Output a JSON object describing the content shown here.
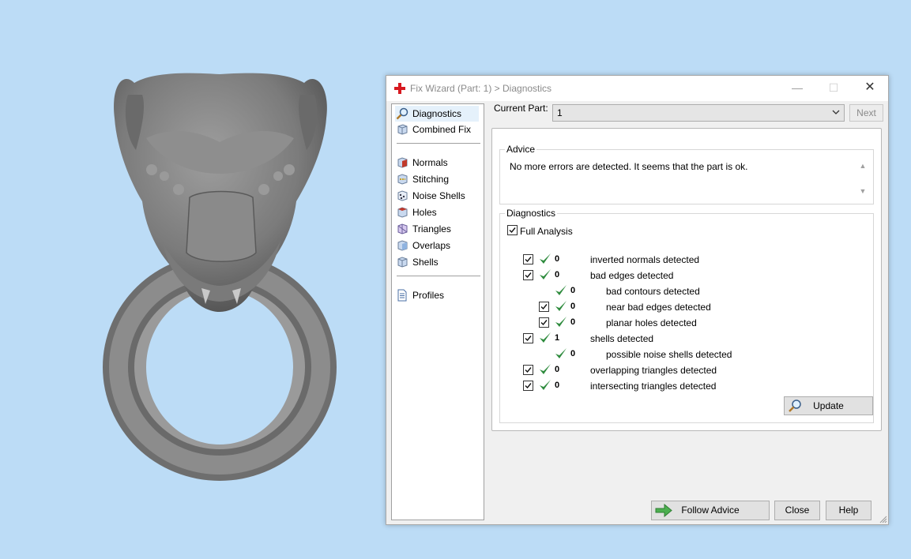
{
  "window": {
    "title": "Fix Wizard (Part: 1) > Diagnostics",
    "min_icon": "minimize-icon",
    "max_icon": "maximize-icon",
    "close_icon": "close-icon"
  },
  "sidebar": {
    "items_top": [
      {
        "label": "Diagnostics",
        "icon": "magnifier-icon",
        "selected": true
      },
      {
        "label": "Combined Fix",
        "icon": "cube-icon",
        "selected": false
      }
    ],
    "items_mid": [
      {
        "label": "Normals",
        "icon": "normals-cube-icon"
      },
      {
        "label": "Stitching",
        "icon": "stitching-cube-icon"
      },
      {
        "label": "Noise Shells",
        "icon": "noise-shells-cube-icon"
      },
      {
        "label": "Holes",
        "icon": "holes-cube-icon"
      },
      {
        "label": "Triangles",
        "icon": "triangles-cube-icon"
      },
      {
        "label": "Overlaps",
        "icon": "overlaps-cube-icon"
      },
      {
        "label": "Shells",
        "icon": "shells-cube-icon"
      }
    ],
    "items_bottom": [
      {
        "label": "Profiles",
        "icon": "document-icon"
      }
    ]
  },
  "part": {
    "label": "Current Part:",
    "value": "1",
    "next_label": "Next"
  },
  "advice": {
    "title": "Advice",
    "text": "No more errors are detected. It seems that the part is ok."
  },
  "diagnostics": {
    "title": "Diagnostics",
    "full_analysis_label": "Full Analysis",
    "full_analysis_checked": true,
    "rows": [
      {
        "checkbox": true,
        "value": "0",
        "label": "inverted normals detected",
        "indent": 0
      },
      {
        "checkbox": true,
        "value": "0",
        "label": "bad edges detected",
        "indent": 0
      },
      {
        "checkbox": false,
        "value": "0",
        "label": "bad contours detected",
        "indent": 1
      },
      {
        "checkbox": true,
        "value": "0",
        "label": "near bad edges detected",
        "indent": 1
      },
      {
        "checkbox": true,
        "value": "0",
        "label": "planar holes detected",
        "indent": 1
      },
      {
        "checkbox": true,
        "value": "1",
        "label": "shells detected",
        "indent": 0
      },
      {
        "checkbox": false,
        "value": "0",
        "label": "possible noise shells detected",
        "indent": 1
      },
      {
        "checkbox": true,
        "value": "0",
        "label": "overlapping triangles detected",
        "indent": 0
      },
      {
        "checkbox": true,
        "value": "0",
        "label": "intersecting triangles detected",
        "indent": 0
      }
    ],
    "update_label": "Update"
  },
  "footer": {
    "follow_label": "Follow Advice",
    "close_label": "Close",
    "help_label": "Help"
  },
  "colors": {
    "viewport_bg": "#bcdcf6",
    "check_green": "#2e8b3d",
    "accent_red": "#d71920",
    "selection_bg": "#e5f1fb"
  }
}
